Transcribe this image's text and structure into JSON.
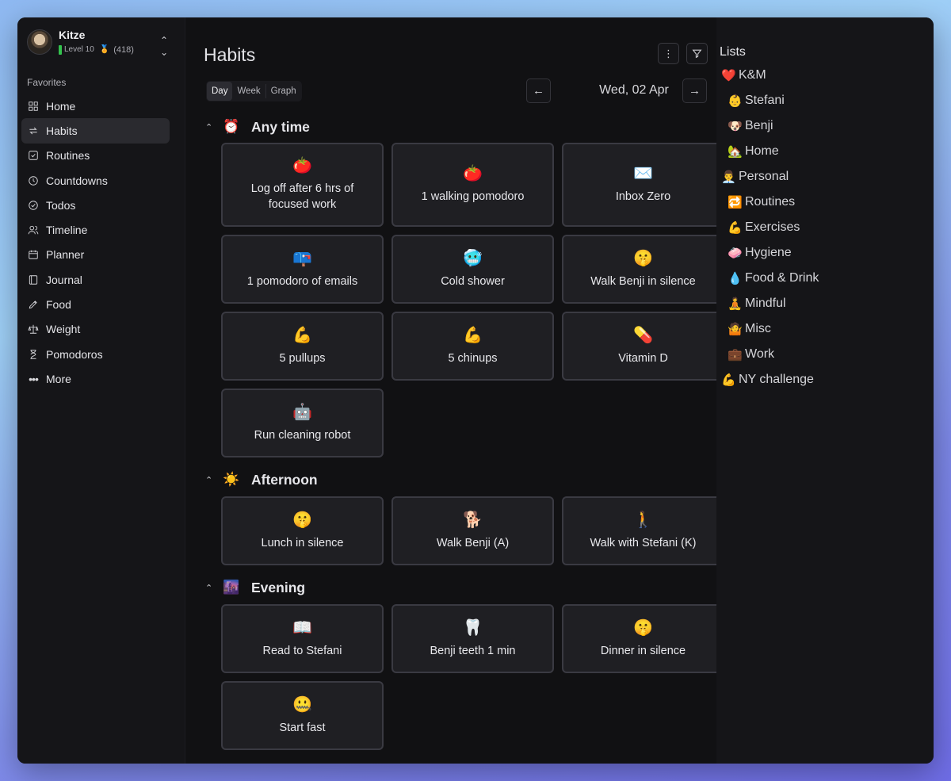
{
  "profile": {
    "name": "Kitze",
    "level": "Level 10",
    "medal": "🏅",
    "points": "(418)"
  },
  "sidebar": {
    "section": "Favorites",
    "items": [
      {
        "label": "Home",
        "icon": "grid-icon"
      },
      {
        "label": "Habits",
        "icon": "repeat-icon",
        "active": true
      },
      {
        "label": "Routines",
        "icon": "checkbox-icon"
      },
      {
        "label": "Countdowns",
        "icon": "clock-icon"
      },
      {
        "label": "Todos",
        "icon": "check-circle-icon"
      },
      {
        "label": "Timeline",
        "icon": "users-icon"
      },
      {
        "label": "Planner",
        "icon": "calendar-icon"
      },
      {
        "label": "Journal",
        "icon": "book-icon"
      },
      {
        "label": "Food",
        "icon": "pen-icon"
      },
      {
        "label": "Weight",
        "icon": "scale-icon"
      },
      {
        "label": "Pomodoros",
        "icon": "hourglass-icon"
      },
      {
        "label": "More",
        "icon": "more-icon"
      }
    ]
  },
  "main": {
    "title": "Habits",
    "views": [
      "Day",
      "Week",
      "Graph"
    ],
    "date": "Wed, 02 Apr",
    "groups": [
      {
        "emoji": "⏰",
        "title": "Any time",
        "habits": [
          {
            "emoji": "🍅",
            "label": "Log off after 6 hrs of focused work"
          },
          {
            "emoji": "🍅",
            "label": "1 walking pomodoro"
          },
          {
            "emoji": "✉️",
            "label": "Inbox Zero"
          },
          {
            "emoji": "📪",
            "label": "1 pomodoro of emails"
          },
          {
            "emoji": "🥶",
            "label": "Cold shower"
          },
          {
            "emoji": "🤫",
            "label": "Walk Benji in silence"
          },
          {
            "emoji": "💪",
            "label": "5 pullups"
          },
          {
            "emoji": "💪",
            "label": "5 chinups"
          },
          {
            "emoji": "💊",
            "label": "Vitamin D"
          },
          {
            "emoji": "🤖",
            "label": "Run cleaning robot"
          }
        ]
      },
      {
        "emoji": "☀️",
        "title": "Afternoon",
        "habits": [
          {
            "emoji": "🤫",
            "label": "Lunch in silence"
          },
          {
            "emoji": "🐕",
            "label": "Walk Benji (A)"
          },
          {
            "emoji": "🚶",
            "label": "Walk with Stefani (K)"
          }
        ]
      },
      {
        "emoji": "🌆",
        "title": "Evening",
        "habits": [
          {
            "emoji": "📖",
            "label": "Read to Stefani"
          },
          {
            "emoji": "🦷",
            "label": "Benji teeth 1 min"
          },
          {
            "emoji": "🤫",
            "label": "Dinner in silence"
          },
          {
            "emoji": "🤐",
            "label": "Start fast"
          }
        ]
      }
    ]
  },
  "lists": {
    "title": "Lists",
    "items": [
      {
        "emoji": "❤️",
        "label": "K&M",
        "indent": false
      },
      {
        "emoji": "👶",
        "label": "Stefani",
        "indent": true
      },
      {
        "emoji": "🐶",
        "label": "Benji",
        "indent": true
      },
      {
        "emoji": "🏡",
        "label": "Home",
        "indent": true
      },
      {
        "emoji": "👨‍💼",
        "label": "Personal",
        "indent": false
      },
      {
        "emoji": "🔁",
        "label": "Routines",
        "indent": true
      },
      {
        "emoji": "💪",
        "label": "Exercises",
        "indent": true
      },
      {
        "emoji": "🧼",
        "label": "Hygiene",
        "indent": true
      },
      {
        "emoji": "💧",
        "label": "Food & Drink",
        "indent": true
      },
      {
        "emoji": "🧘",
        "label": "Mindful",
        "indent": true
      },
      {
        "emoji": "🤷",
        "label": "Misc",
        "indent": true
      },
      {
        "emoji": "💼",
        "label": "Work",
        "indent": true
      },
      {
        "emoji": "💪",
        "label": "NY challenge",
        "indent": false
      }
    ]
  }
}
